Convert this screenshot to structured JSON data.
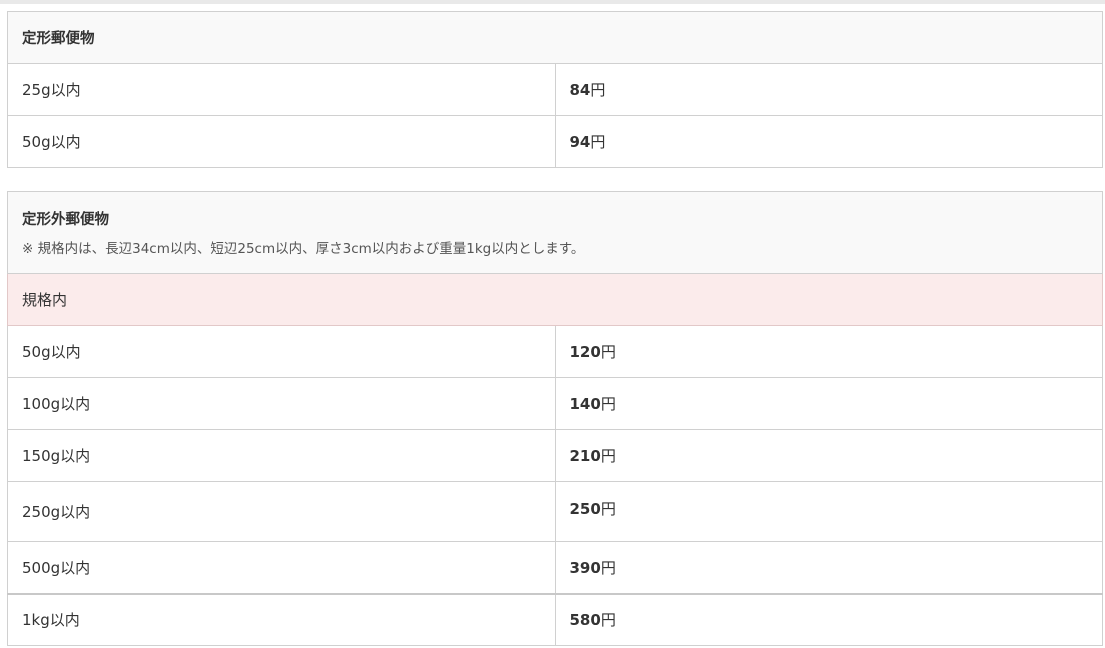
{
  "sections": [
    {
      "title": "定形郵便物",
      "rows": [
        {
          "weight": "25g以内",
          "price": "84",
          "unit": "円"
        },
        {
          "weight": "50g以内",
          "price": "94",
          "unit": "円"
        }
      ]
    },
    {
      "title": "定形外郵便物",
      "note": "※ 規格内は、長辺34cm以内、短辺25cm以内、厚さ3cm以内および重量1kg以内とします。",
      "subheader": "規格内",
      "rows": [
        {
          "weight": "50g以内",
          "price": "120",
          "unit": "円"
        },
        {
          "weight": "100g以内",
          "price": "140",
          "unit": "円"
        },
        {
          "weight": "150g以内",
          "price": "210",
          "unit": "円"
        },
        {
          "weight": "250g以内",
          "price": "250",
          "unit": "円"
        },
        {
          "weight": "500g以内",
          "price": "390",
          "unit": "円"
        },
        {
          "weight": "1kg以内",
          "price": "580",
          "unit": "円"
        }
      ]
    }
  ],
  "colors": {
    "header_bg": "#f9f9f9",
    "subheader_bg": "#fbebeb",
    "border": "#d0d0d0"
  }
}
